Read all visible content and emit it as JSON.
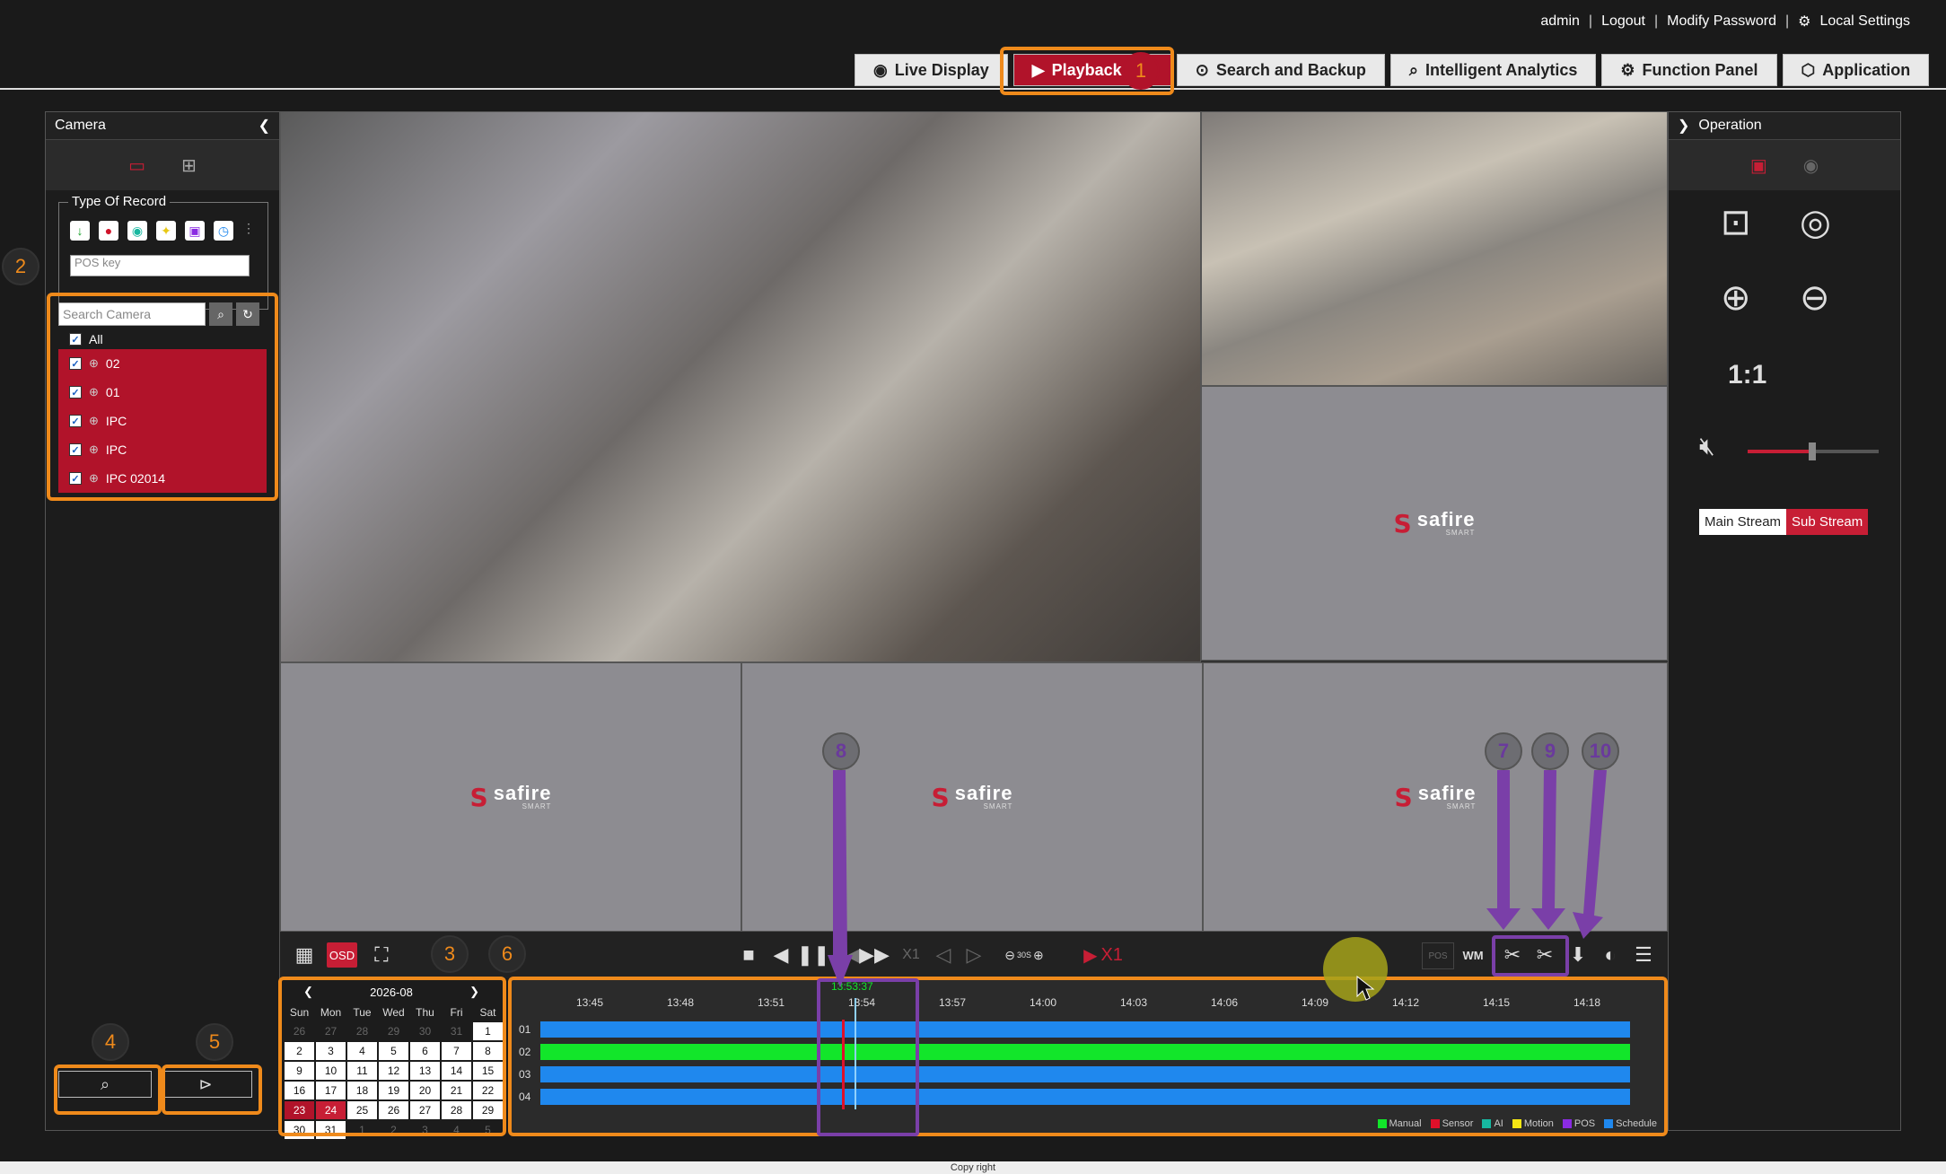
{
  "header": {
    "user": "admin",
    "logout": "Logout",
    "modify_password": "Modify Password",
    "local_settings": "Local Settings"
  },
  "nav": {
    "tabs": [
      {
        "label": "Live Display",
        "icon": "camera-icon"
      },
      {
        "label": "Playback",
        "icon": "play-icon",
        "active": true
      },
      {
        "label": "Search and Backup",
        "icon": "search-icon"
      },
      {
        "label": "Intelligent Analytics",
        "icon": "analytics-icon"
      },
      {
        "label": "Function Panel",
        "icon": "gear-icon"
      },
      {
        "label": "Application",
        "icon": "cube-icon"
      }
    ]
  },
  "left": {
    "title": "Camera",
    "record_type_title": "Type Of Record",
    "pos_placeholder": "POS key",
    "search_placeholder": "Search Camera",
    "cameras": [
      {
        "label": "All"
      },
      {
        "label": "02"
      },
      {
        "label": "01"
      },
      {
        "label": "IPC"
      },
      {
        "label": "IPC"
      },
      {
        "label": "IPC 02014"
      }
    ]
  },
  "right": {
    "title": "Operation",
    "main_stream": "Main Stream",
    "sub_stream": "Sub Stream",
    "ratio": "1:1"
  },
  "controls": {
    "osd": "OSD",
    "speed": "X1",
    "speed_red": "X1",
    "pos": "POS",
    "wm": "WM",
    "step": "30S"
  },
  "calendar": {
    "month": "2026-08",
    "weekdays": [
      "Sun",
      "Mon",
      "Tue",
      "Wed",
      "Thu",
      "Fri",
      "Sat"
    ],
    "days": [
      "26",
      "27",
      "28",
      "29",
      "30",
      "31",
      "1",
      "2",
      "3",
      "4",
      "5",
      "6",
      "7",
      "8",
      "9",
      "10",
      "11",
      "12",
      "13",
      "14",
      "15",
      "16",
      "17",
      "18",
      "19",
      "20",
      "21",
      "22",
      "23",
      "24",
      "25",
      "26",
      "27",
      "28",
      "29",
      "30",
      "31",
      "1",
      "2",
      "3",
      "4",
      "5"
    ]
  },
  "timeline": {
    "current_time": "13:53:37",
    "ticks": [
      "13:45",
      "13:48",
      "13:51",
      "13:54",
      "13:57",
      "14:00",
      "14:03",
      "14:06",
      "14:09",
      "14:12",
      "14:15",
      "14:18"
    ],
    "rows": [
      "01",
      "02",
      "03",
      "04"
    ],
    "legend": [
      "Manual",
      "Sensor",
      "AI",
      "Motion",
      "POS",
      "Schedule"
    ],
    "legend_colors": [
      "#12e62a",
      "#e0102a",
      "#17b8a0",
      "#f5e614",
      "#8a2be2",
      "#1f88ee"
    ]
  },
  "annotations": [
    "1",
    "2",
    "3",
    "4",
    "5",
    "6",
    "7",
    "8",
    "9",
    "10"
  ],
  "footer": "Copy right"
}
